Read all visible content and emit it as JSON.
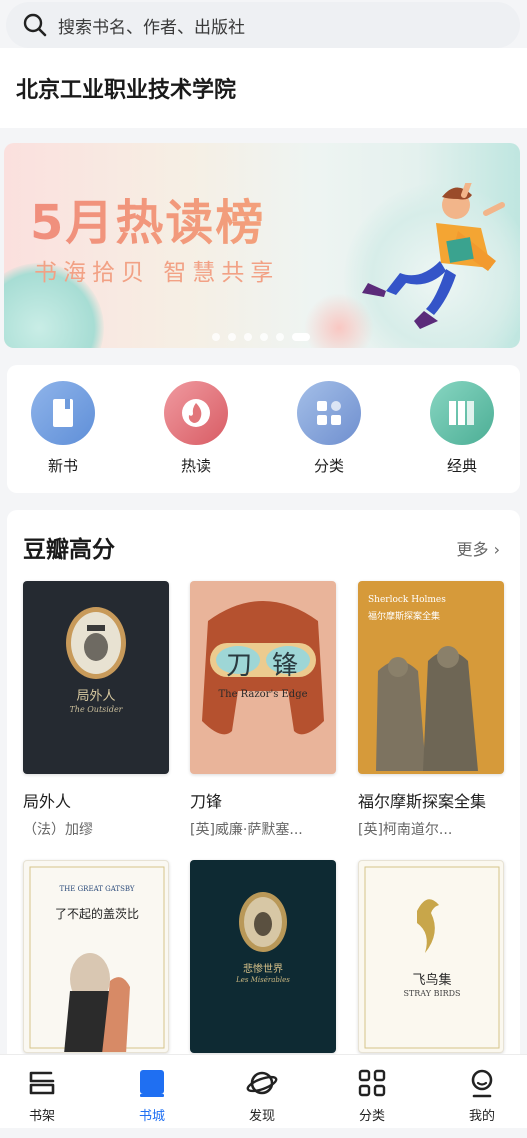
{
  "search": {
    "placeholder": "搜索书名、作者、出版社"
  },
  "school": {
    "name": "北京工业职业技术学院"
  },
  "banner": {
    "title": "5月热读榜",
    "subtitle": "书海拾贝 智慧共享",
    "dot_count": 6,
    "active_dot": 5
  },
  "quick_links": [
    {
      "label": "新书",
      "icon": "book-icon",
      "color": "#6f9bdc"
    },
    {
      "label": "热读",
      "icon": "fire-icon",
      "color": "#e2767a"
    },
    {
      "label": "分类",
      "icon": "grid-icon",
      "color": "#7f9fd6"
    },
    {
      "label": "经典",
      "icon": "books-icon",
      "color": "#5fbfa7"
    }
  ],
  "douban": {
    "title": "豆瓣高分",
    "more": "更多 ›",
    "books": [
      {
        "title": "局外人",
        "author": "（法）加缪",
        "cover_title": "局外人",
        "cover_sub": "The Outsider"
      },
      {
        "title": "刀锋",
        "author": "[英]威廉·萨默塞...",
        "cover_title": "刀锋",
        "cover_sub": "The Razor's Edge"
      },
      {
        "title": "福尔摩斯探案全集",
        "author": "[英]柯南道尔...",
        "cover_title": "福尔摩斯探案全集",
        "cover_sub": "Sherlock Holmes"
      },
      {
        "title": "",
        "author": "",
        "cover_title": "了不起的盖茨比",
        "cover_sub": "THE GREAT GATSBY"
      },
      {
        "title": "",
        "author": "",
        "cover_title": "悲惨世界",
        "cover_sub": "Les Misérables"
      },
      {
        "title": "",
        "author": "",
        "cover_title": "飞鸟集",
        "cover_sub": "STRAY BIRDS"
      }
    ]
  },
  "tabbar": {
    "items": [
      {
        "label": "书架",
        "icon": "bookshelf-icon",
        "active": false
      },
      {
        "label": "书城",
        "icon": "bookstore-icon",
        "active": true
      },
      {
        "label": "发现",
        "icon": "planet-icon",
        "active": false
      },
      {
        "label": "分类",
        "icon": "category-icon",
        "active": false
      },
      {
        "label": "我的",
        "icon": "profile-icon",
        "active": false
      }
    ],
    "active_color": "#1f6ff2"
  }
}
